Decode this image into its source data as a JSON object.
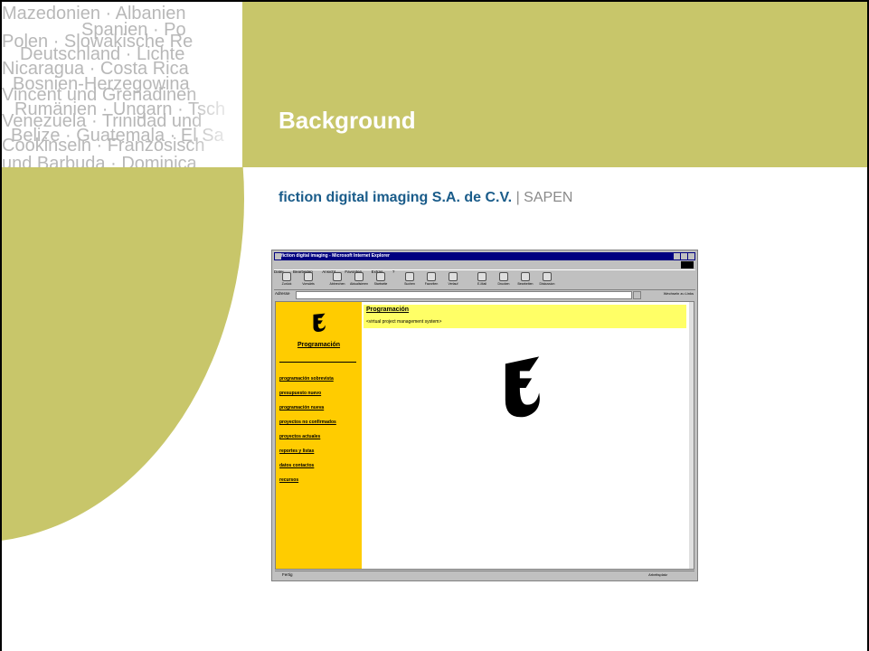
{
  "slide": {
    "title": "Background",
    "company": "fiction digital imaging S.A. de C.V.",
    "separator": "|",
    "project": "SAPEN",
    "colors": {
      "olive": "#c8c66a",
      "company_blue": "#1a5c8a",
      "nav_yellow": "#ffcc00",
      "header_yellow": "#ffff66"
    },
    "countries": [
      "Mazedonien · Albanien",
      "Polen · Slowakische Re",
      "Spanien · Po",
      "Deutschland · Lichte",
      "Nicaragua · Costa Rica",
      "Vincent und Grenadinen",
      "Bosnien-Herzegowina",
      "Venezuela · Trinidad und",
      "Rumänien · Ungarn · Tsch",
      "Belize · Guatemala · El Sa",
      "Cookinseln · Französisch",
      "und Barbuda · Dominica"
    ]
  },
  "browser": {
    "window_title": "fiction digital imaging - Microsoft Internet Explorer",
    "menu": [
      "Datei",
      "Bearbeiten",
      "Ansicht",
      "Favoriten",
      "Extras",
      "?"
    ],
    "toolbar": [
      "Zurück",
      "Vorwärts",
      "Abbrechen",
      "Aktualisieren",
      "Startseite",
      "Suchen",
      "Favoriten",
      "Verlauf",
      "E-Mail",
      "Drucken",
      "Bearbeiten",
      "Diskussion"
    ],
    "address_label": "Adresse",
    "links_label": "Wechseln zu   Links",
    "status_left": "Fertig",
    "status_zone": "Arbeitsplatz",
    "left_frame": {
      "heading": "Programación",
      "links": [
        "programación sobrevista",
        "presupuesto nuevo",
        "programación nueva",
        "proyectos no confirmados",
        "proyectos actuales",
        "reportes y listas",
        "datos contactos",
        "recursos"
      ]
    },
    "right_frame": {
      "heading": "Programación",
      "subtitle": "<virtual project management system>"
    }
  }
}
